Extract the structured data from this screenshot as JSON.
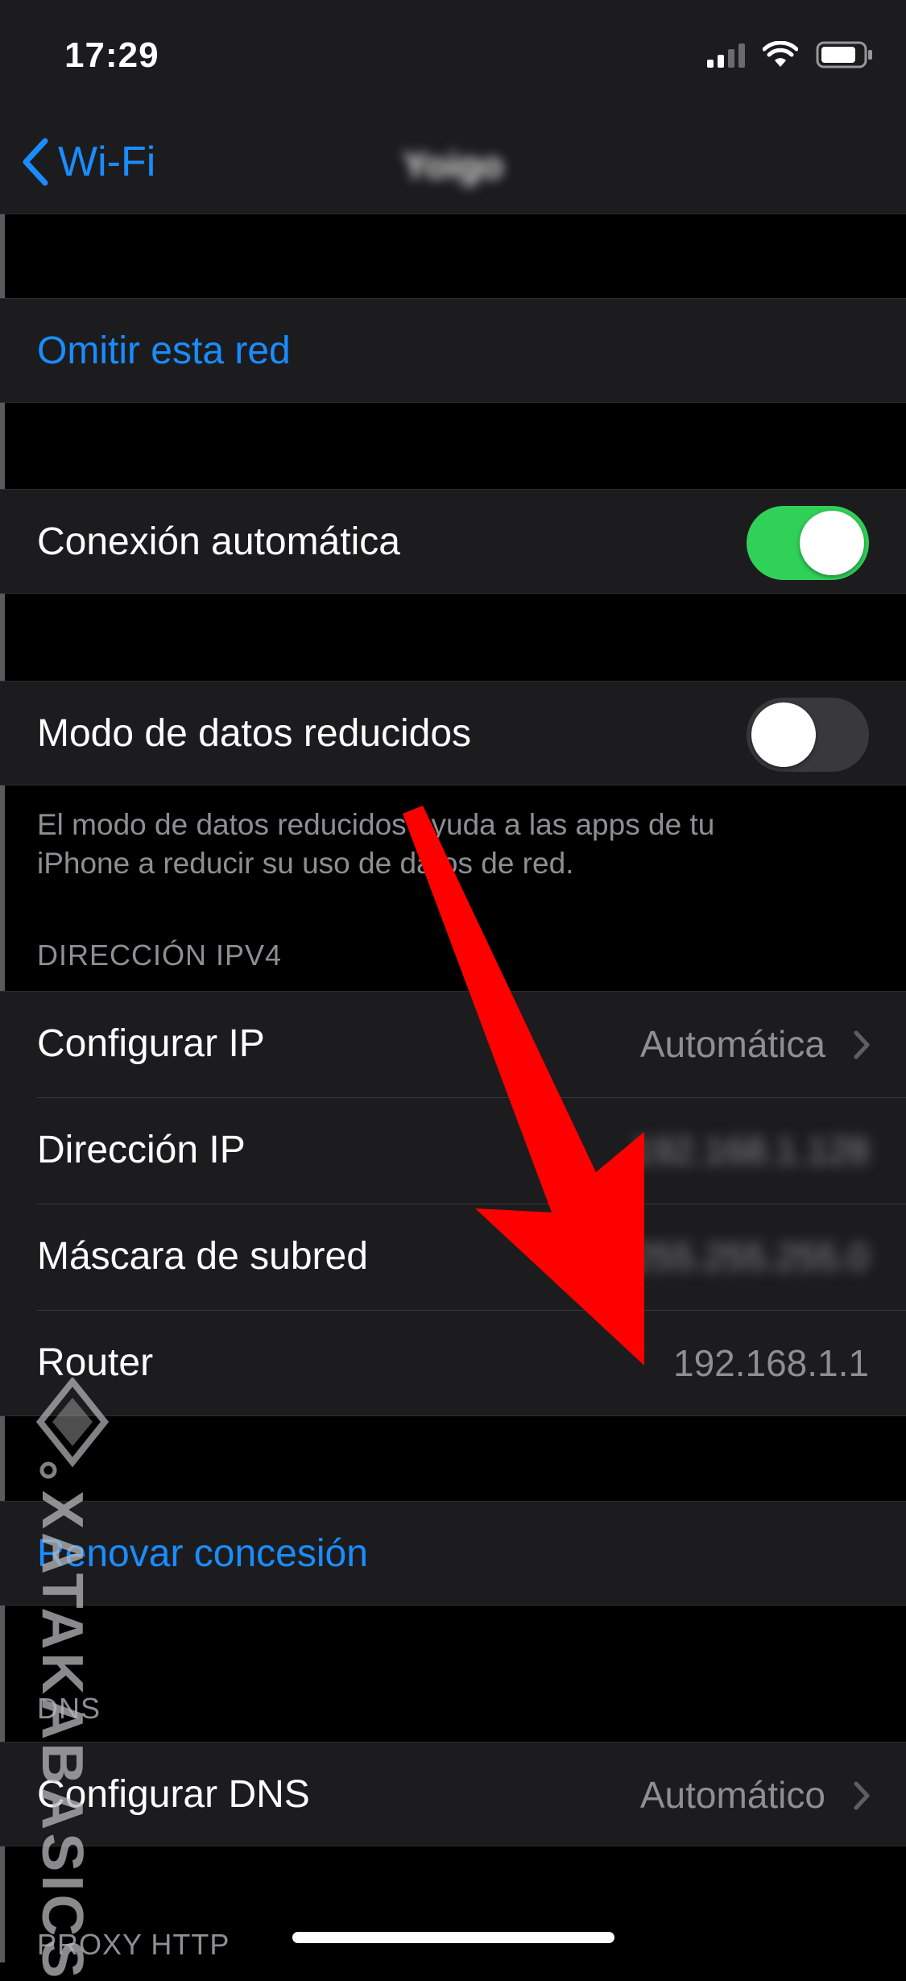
{
  "status_bar": {
    "time": "17:29"
  },
  "nav": {
    "back_label": "Wi-Fi",
    "title": "Yoigo"
  },
  "rows": {
    "forget_network": "Omitir esta red",
    "auto_join": "Conexión automática",
    "low_data_mode": "Modo de datos reducidos",
    "low_data_footer": "El modo de datos reducidos ayuda a las apps de tu iPhone a reducir su uso de datos de red.",
    "configure_ip": {
      "label": "Configurar IP",
      "value": "Automática"
    },
    "ip_address": {
      "label": "Dirección IP",
      "value": "192.168.1.128"
    },
    "subnet_mask": {
      "label": "Máscara de subred",
      "value": "255.255.255.0"
    },
    "router": {
      "label": "Router",
      "value": "192.168.1.1"
    },
    "renew_lease": "Renovar concesión",
    "configure_dns": {
      "label": "Configurar DNS",
      "value": "Automático"
    }
  },
  "sections": {
    "ipv4": "DIRECCIÓN IPV4",
    "dns": "DNS",
    "proxy": "PROXY HTTP"
  },
  "toggles": {
    "auto_join": true,
    "low_data_mode": false
  },
  "watermark": {
    "text": "XATAKABASICS"
  },
  "colors": {
    "accent": "#1a8cff",
    "toggle_on": "#30d158",
    "arrow": "#ff0000"
  },
  "icons": [
    "signal-icon",
    "wifi-icon",
    "battery-icon",
    "chevron-left-icon",
    "chevron-right-icon",
    "arrow-annotation-icon"
  ]
}
